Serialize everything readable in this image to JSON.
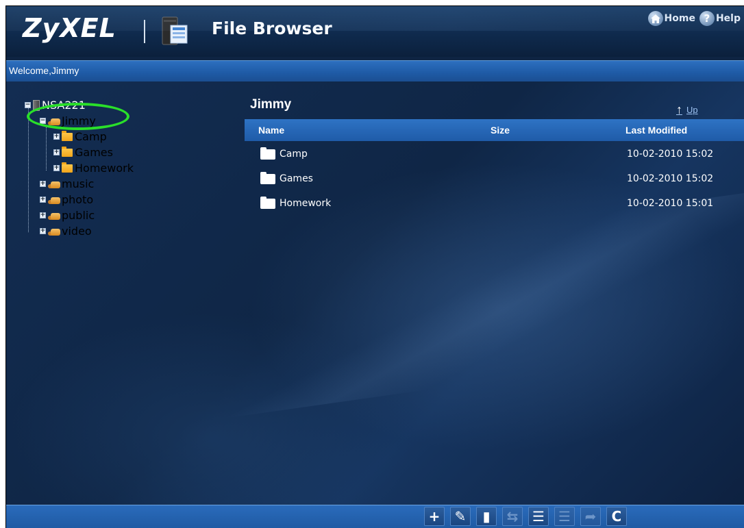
{
  "header": {
    "logo": "ZyXEL",
    "app_title": "File Browser",
    "home_label": "Home",
    "help_label": "Help",
    "help_glyph": "?"
  },
  "welcome": "Welcome,Jimmy",
  "tree": {
    "root": "NSA221",
    "jimmy": "Jimmy",
    "camp": "Camp",
    "games": "Games",
    "homework": "Homework",
    "music": "music",
    "photo": "photo",
    "public": "public",
    "video": "video"
  },
  "main": {
    "folder_title": "Jimmy",
    "up_label": "Up",
    "columns": {
      "name": "Name",
      "size": "Size",
      "modified": "Last Modified"
    },
    "rows": [
      {
        "name": "Camp",
        "size": "",
        "modified": "10-02-2010 15:02"
      },
      {
        "name": "Games",
        "size": "",
        "modified": "10-02-2010 15:02"
      },
      {
        "name": "Homework",
        "size": "",
        "modified": "10-02-2010 15:01"
      }
    ]
  },
  "toolbar": {
    "buttons": [
      {
        "icon": "add-icon",
        "glyph": "+",
        "enabled": true
      },
      {
        "icon": "edit-icon",
        "glyph": "✎",
        "enabled": true
      },
      {
        "icon": "delete-icon",
        "glyph": "▮",
        "enabled": true
      },
      {
        "icon": "copy-icon",
        "glyph": "⇆",
        "enabled": false
      },
      {
        "icon": "upload-icon",
        "glyph": "☰",
        "enabled": true
      },
      {
        "icon": "download-icon",
        "glyph": "☰",
        "enabled": false
      },
      {
        "icon": "move-icon",
        "glyph": "➦",
        "enabled": false
      },
      {
        "icon": "refresh-icon",
        "glyph": "C",
        "enabled": true
      }
    ]
  },
  "colors": {
    "accent": "#1f5ba8",
    "highlight_ellipse": "#2adf2a",
    "background": "#0e2443"
  }
}
